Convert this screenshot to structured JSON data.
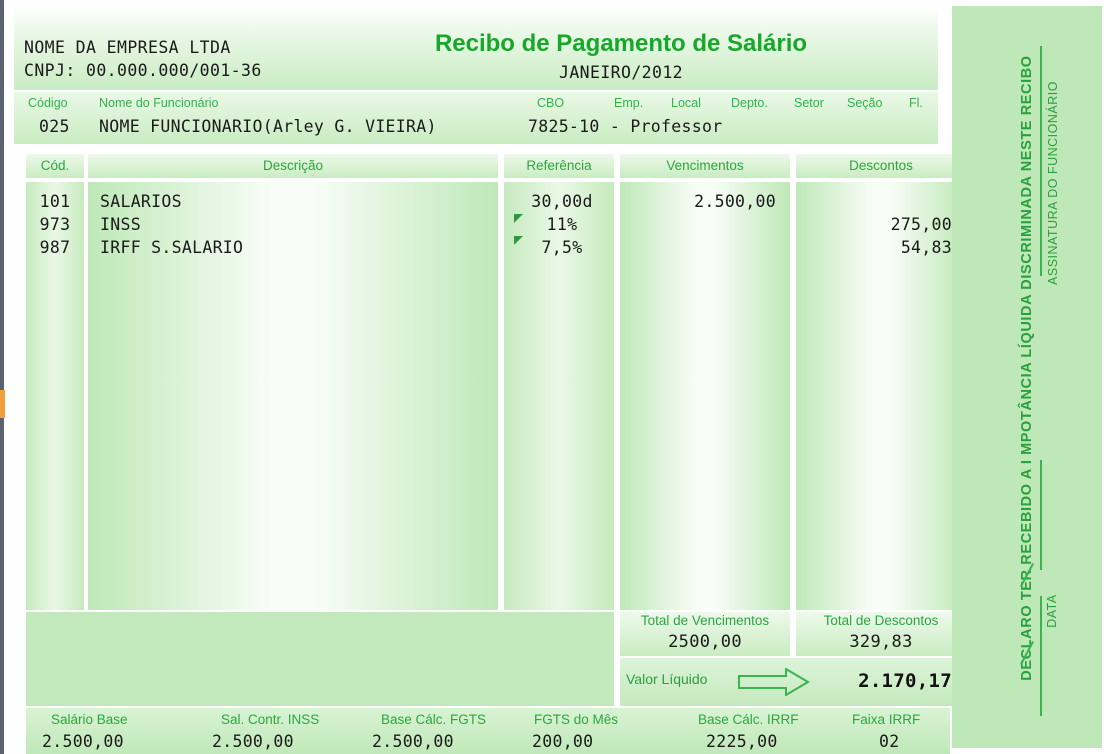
{
  "document": {
    "title": "Recibo de Pagamento de Salário",
    "period": "JANEIRO/2012",
    "company_name": "NOME DA EMPRESA LTDA",
    "company_cnpj": "CNPJ: 00.000.000/001-36"
  },
  "employee": {
    "headers": {
      "codigo": "Código",
      "nome": "Nome do Funcionário",
      "cbo": "CBO",
      "emp": "Emp.",
      "local": "Local",
      "depto": "Depto.",
      "setor": "Setor",
      "secao": "Seção",
      "fl": "Fl."
    },
    "values": {
      "codigo": "025",
      "nome": "NOME FUNCIONARIO(Arley G. VIEIRA)",
      "cbo": "7825-10 - Professor"
    }
  },
  "table": {
    "headers": {
      "cod": "Cód.",
      "descricao": "Descrição",
      "referencia": "Referência",
      "vencimentos": "Vencimentos",
      "descontos": "Descontos"
    },
    "rows": [
      {
        "cod": "101",
        "descricao": "SALARIOS",
        "referencia": "30,00d",
        "vencimentos": "2.500,00",
        "descontos": "",
        "marker": false
      },
      {
        "cod": "973",
        "descricao": "INSS",
        "referencia": "11%",
        "vencimentos": "",
        "descontos": "275,00",
        "marker": true
      },
      {
        "cod": "987",
        "descricao": "IRFF S.SALARIO",
        "referencia": "7,5%",
        "vencimentos": "",
        "descontos": "54,83",
        "marker": true
      }
    ]
  },
  "totals": {
    "vencimentos_label": "Total de Vencimentos",
    "vencimentos_value": "2500,00",
    "descontos_label": "Total de Descontos",
    "descontos_value": "329,83",
    "liquido_label": "Valor Líquido",
    "liquido_value": "2.170,17",
    "arrow_icon": "arrow-right-icon"
  },
  "bases": [
    {
      "label": "Salário Base",
      "value": "2.500,00"
    },
    {
      "label": "Sal. Contr. INSS",
      "value": "2.500,00"
    },
    {
      "label": "Base Cálc. FGTS",
      "value": "2.500,00"
    },
    {
      "label": "FGTS do Mês",
      "value": "200,00"
    },
    {
      "label": "Base Cálc. IRRF",
      "value": "2225,00"
    },
    {
      "label": "Faixa IRRF",
      "value": "02"
    }
  ],
  "signature_panel": {
    "declaration": "DECLARO TER RECEBIDO  A I MPOTÂNCIA LÍQUIDA DISCRIMINADA NESTE RECIBO",
    "date_caption": "DATA",
    "signature_caption": "ASSINATURA DO FUNCIONÁRIO"
  },
  "colors": {
    "accent_green": "#17a82b",
    "header_green": "#28a83e",
    "panel_green": "#bfe8b8",
    "block_green": "#c2e9bc",
    "left_rule": "#5a6270",
    "left_marker": "#f0a13c"
  }
}
